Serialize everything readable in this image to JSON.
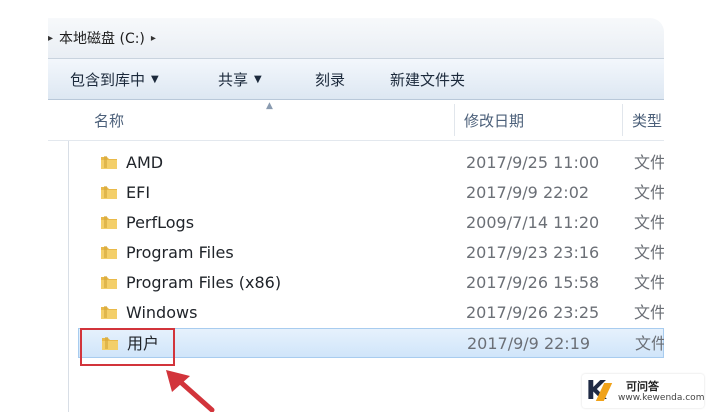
{
  "address_bar": {
    "root_arrow": "▸",
    "path": [
      "本地磁盘 (C:)"
    ],
    "trailing_arrow": "▸"
  },
  "toolbar": {
    "include_in_library": "包含到库中",
    "share": "共享",
    "burn": "刻录",
    "new_folder": "新建文件夹"
  },
  "columns": {
    "name": "名称",
    "modified": "修改日期",
    "type": "类型"
  },
  "files": [
    {
      "name": "AMD",
      "modified": "2017/9/25 11:00",
      "type": "文件"
    },
    {
      "name": "EFI",
      "modified": "2017/9/9 22:02",
      "type": "文件"
    },
    {
      "name": "PerfLogs",
      "modified": "2009/7/14 11:20",
      "type": "文件"
    },
    {
      "name": "Program Files",
      "modified": "2017/9/23 23:16",
      "type": "文件"
    },
    {
      "name": "Program Files (x86)",
      "modified": "2017/9/26 15:58",
      "type": "文件"
    },
    {
      "name": "Windows",
      "modified": "2017/9/26 23:25",
      "type": "文件"
    },
    {
      "name": "用户",
      "modified": "2017/9/9 22:19",
      "type": "文件",
      "selected": true
    }
  ],
  "watermark": {
    "logo_letter": "K",
    "title": "可问答",
    "site": "www.kewenda.com"
  },
  "colors": {
    "highlight_box": "#d2343b",
    "selection": "#d0e5fa",
    "folder": "#e9b949"
  }
}
